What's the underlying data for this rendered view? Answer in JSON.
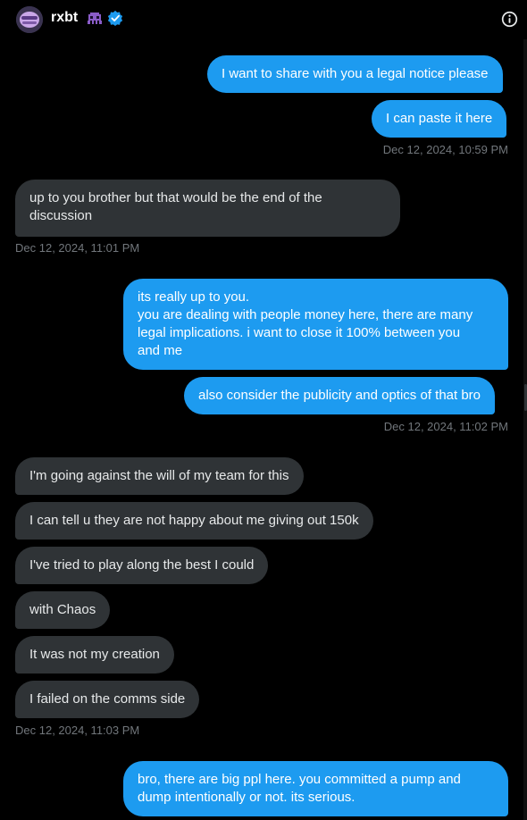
{
  "header": {
    "name": "rxbt"
  },
  "messages": [
    {
      "text": "I want to share with you a legal notice please"
    },
    {
      "text": "I can paste it here"
    },
    {
      "text": "Dec 12, 2024, 10:59 PM"
    },
    {
      "text": "up to you brother but that would be the end of the\ndiscussion"
    },
    {
      "text": "Dec 12, 2024, 11:01 PM"
    },
    {
      "text": "its really up to you.\nyou are dealing with people money here, there are many\nlegal implications. i want to close it 100% between you\nand me"
    },
    {
      "text": "also consider the publicity and optics of that bro"
    },
    {
      "text": "Dec 12, 2024, 11:02 PM"
    },
    {
      "text": "I'm going against the will of my team for this"
    },
    {
      "text": "I can tell u they are not happy about me giving out 150k"
    },
    {
      "text": "I've tried to play along the best I could"
    },
    {
      "text": "with Chaos"
    },
    {
      "text": "It was not my creation"
    },
    {
      "text": "I failed on the comms side"
    },
    {
      "text": "Dec 12, 2024, 11:03 PM"
    },
    {
      "text": "bro, there are big ppl here. you committed a pump and\ndump intentionally or not. its serious."
    }
  ],
  "colors": {
    "outgoing": "#1d9bf0",
    "incoming": "#2f3336",
    "timestamp": "#71767b",
    "background": "#000000"
  }
}
